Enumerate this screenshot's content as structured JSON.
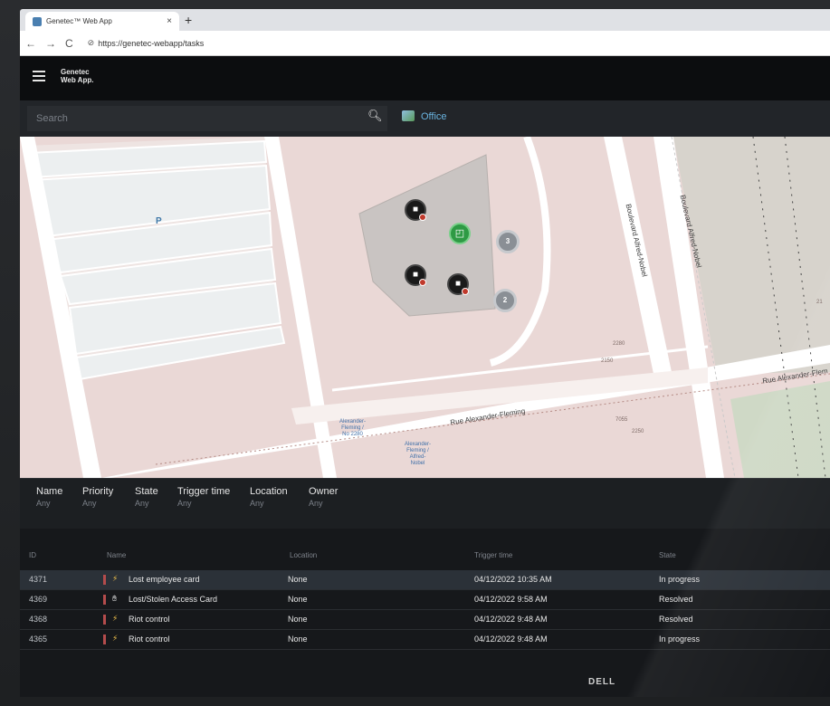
{
  "browser": {
    "tab_title": "Genetec™ Web App",
    "tab_close": "×",
    "new_tab": "+",
    "back": "←",
    "forward": "→",
    "reload": "C",
    "url": "https://genetec-webapp/tasks"
  },
  "app": {
    "logo_line1": "Genetec",
    "logo_line2": "Web App."
  },
  "search": {
    "placeholder": "Search",
    "site_label": "Office"
  },
  "map": {
    "parking_label": "P",
    "street_boulevard_1": "Boulevard Alfred-Nobel",
    "street_boulevard_2": "Boulevard Alfred-Nobel",
    "street_rue_1": "Rue Alexander-Fleming",
    "street_rue_2": "Rue Alexander-Flem",
    "stop_1": "Alexander-\nFleming /\nNo 2280",
    "stop_2": "Alexander-\nFleming /\nAlfred-\nNobel",
    "addr_2280": "2280",
    "addr_2150": "2150",
    "addr_2250": "2250",
    "addr_7055": "7055",
    "addr_21": "21",
    "cluster_1": "3",
    "cluster_2": "2"
  },
  "filters": [
    {
      "label": "Name",
      "value": "Any"
    },
    {
      "label": "Priority",
      "value": "Any"
    },
    {
      "label": "State",
      "value": "Any"
    },
    {
      "label": "Trigger time",
      "value": "Any"
    },
    {
      "label": "Location",
      "value": "Any"
    },
    {
      "label": "Owner",
      "value": "Any"
    }
  ],
  "table": {
    "columns": {
      "id": "ID",
      "name": "Name",
      "location": "Location",
      "trigger": "Trigger time",
      "state": "State"
    },
    "rows": [
      {
        "id": "4371",
        "name": "Lost employee card",
        "location": "None",
        "trigger": "04/12/2022 10:35 AM",
        "state": "In progress",
        "icon": "bolt-icon"
      },
      {
        "id": "4369",
        "name": "Lost/Stolen Access Card",
        "location": "None",
        "trigger": "04/12/2022 9:58 AM",
        "state": "Resolved",
        "icon": "hand-icon"
      },
      {
        "id": "4368",
        "name": "Riot control",
        "location": "None",
        "trigger": "04/12/2022 9:48 AM",
        "state": "Resolved",
        "icon": "bolt-icon"
      },
      {
        "id": "4365",
        "name": "Riot control",
        "location": "None",
        "trigger": "04/12/2022 9:48 AM",
        "state": "In progress",
        "icon": "bolt-icon"
      }
    ]
  },
  "device_brand": "DELL",
  "colors": {
    "accent": "#6ab4e0",
    "priority": "#b44c4c",
    "door_online": "#2e9a44"
  }
}
